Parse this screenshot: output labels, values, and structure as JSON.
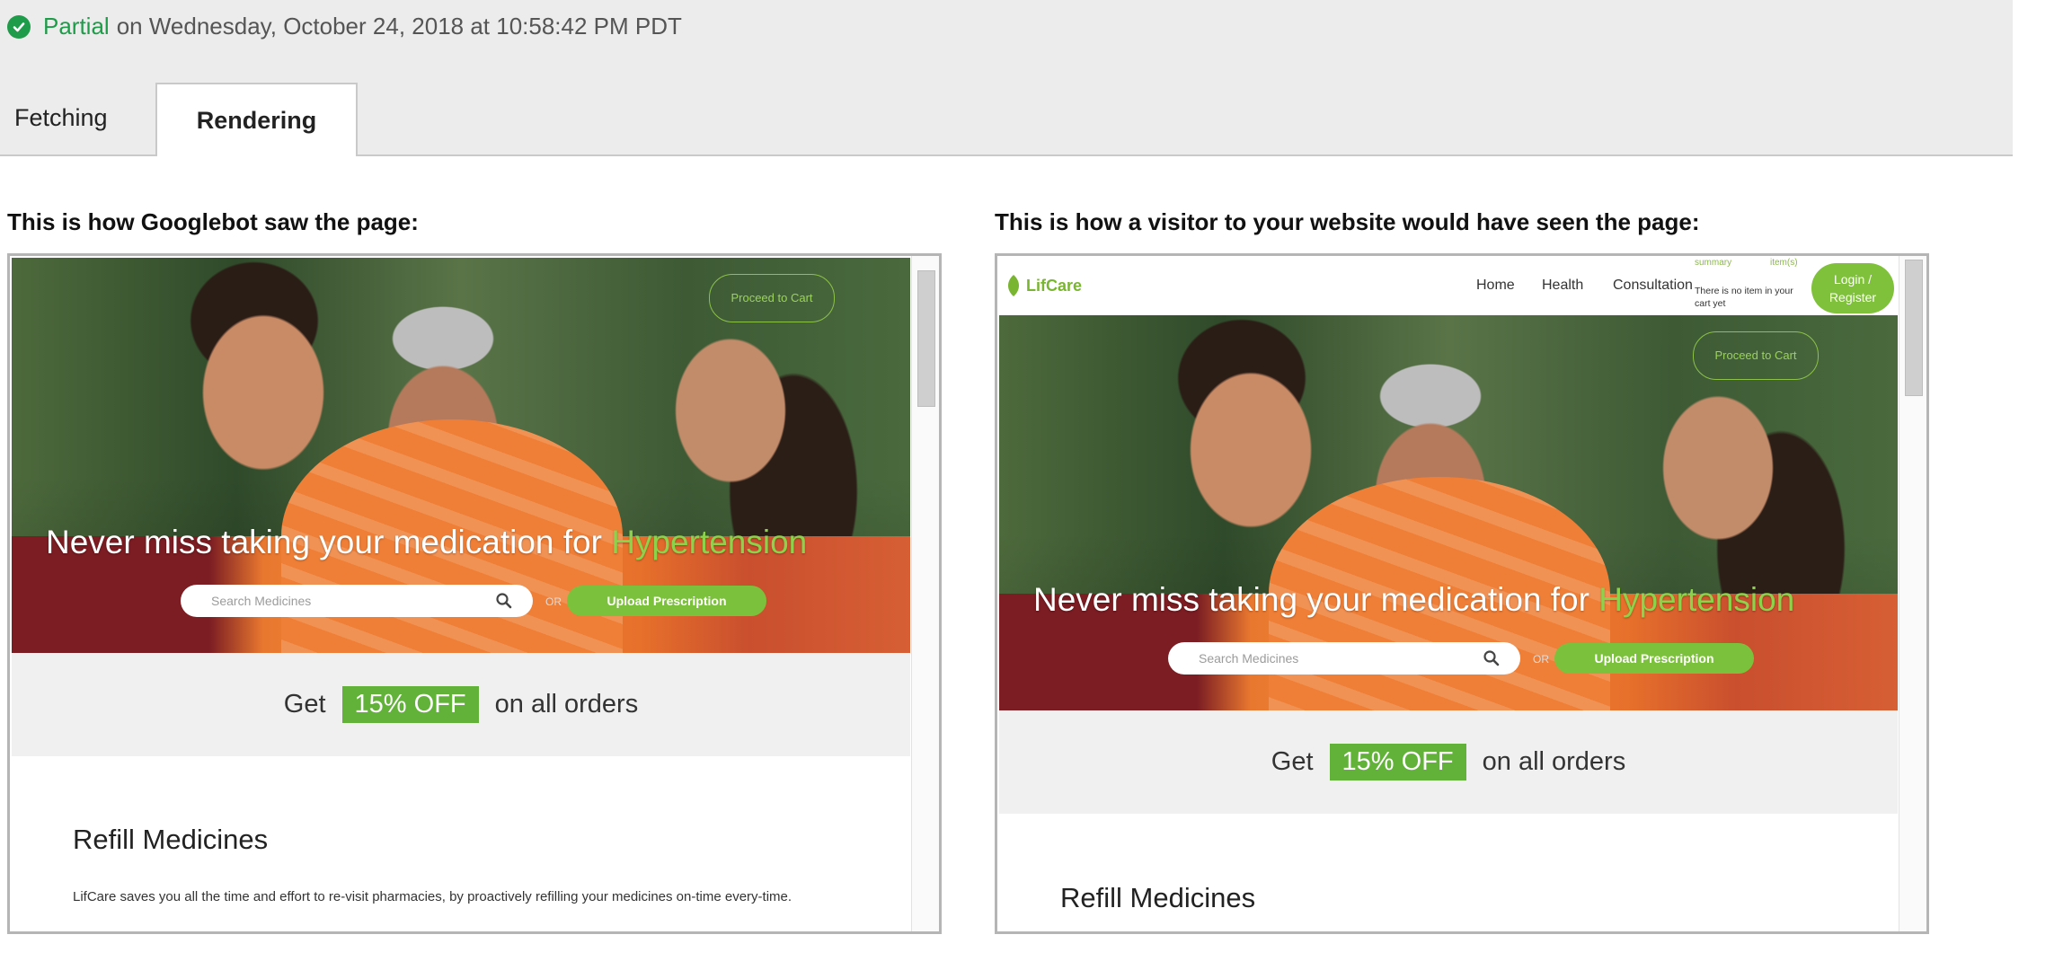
{
  "status": {
    "word": "Partial",
    "text": "on Wednesday, October 24, 2018 at 10:58:42 PM PDT",
    "color": "#1e9c49"
  },
  "tabs": [
    {
      "label": "Fetching"
    },
    {
      "label": "Rendering"
    }
  ],
  "left": {
    "heading": "This is how Googlebot saw the page:",
    "page": {
      "proceed": "Proceed to Cart",
      "headline_main": "Never miss taking your medication for ",
      "headline_highlight": "Hypertension",
      "search_placeholder": "Search Medicines",
      "or": "OR",
      "upload": "Upload Prescription",
      "promo_get": "Get",
      "promo_off": "15% OFF",
      "promo_rest": "on all orders",
      "refill_title": "Refill Medicines",
      "refill_text": "LifCare saves you all the time and effort to re-visit pharmacies, by proactively refilling your medicines on-time every-time."
    }
  },
  "right": {
    "heading": "This is how a visitor to your website would have seen the page:",
    "page": {
      "logo": "LifCare",
      "nav": [
        "Home",
        "Health",
        "Consultation"
      ],
      "cart_top": [
        "summary",
        "item(s)"
      ],
      "cart_note": "There is no item in your cart yet",
      "login": "Login / Register",
      "proceed": "Proceed to Cart",
      "headline_main": "Never miss taking your medication for ",
      "headline_highlight": "Hypertension",
      "search_placeholder": "Search Medicines",
      "or": "OR",
      "upload": "Upload Prescription",
      "promo_get": "Get",
      "promo_off": "15% OFF",
      "promo_rest": "on all orders",
      "refill_title": "Refill Medicines"
    }
  },
  "colors": {
    "accent_green": "#7cc13b",
    "promo_green": "#62b23a",
    "status_green": "#1e9c49"
  }
}
